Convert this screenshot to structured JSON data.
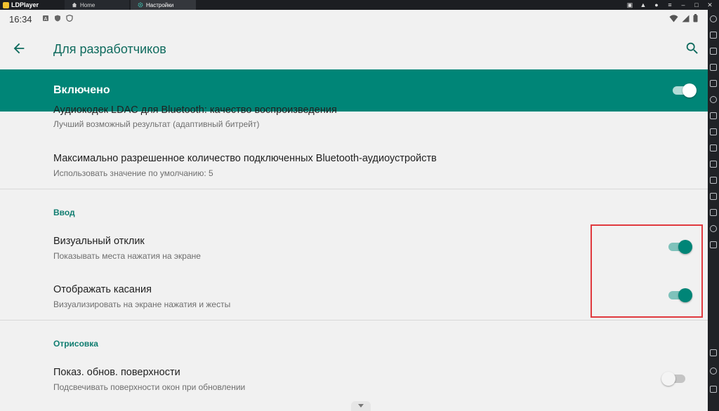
{
  "emulator": {
    "brand": "LDPlayer",
    "tabs": [
      {
        "label": "Home",
        "icon": "home-icon"
      },
      {
        "label": "Настройки",
        "icon": "gear-icon"
      }
    ]
  },
  "statusbar": {
    "time": "16:34"
  },
  "appbar": {
    "title": "Для разработчиков"
  },
  "master": {
    "label": "Включено",
    "enabled": true
  },
  "items": [
    {
      "title": "Аудиокодек LDAC для Bluetooth: качество воспроизведения",
      "subtitle": "Лучший возможный результат (адаптивный битрейт)"
    },
    {
      "title": "Максимально разрешенное количество подключенных Bluetooth-аудиоустройств",
      "subtitle": "Использовать значение по умолчанию: 5"
    }
  ],
  "sections": [
    {
      "header": "Ввод",
      "items": [
        {
          "title": "Визуальный отклик",
          "subtitle": "Показывать места нажатия на экране",
          "enabled": true
        },
        {
          "title": "Отображать касания",
          "subtitle": "Визуализировать на экране нажатия и жесты",
          "enabled": true
        }
      ]
    },
    {
      "header": "Отрисовка",
      "items": [
        {
          "title": "Показ. обнов. поверхности",
          "subtitle": "Подсвечивать поверхности окон при обновлении",
          "enabled": false
        }
      ]
    }
  ],
  "colors": {
    "accent": "#008577",
    "highlight_box": "#e0393e"
  }
}
